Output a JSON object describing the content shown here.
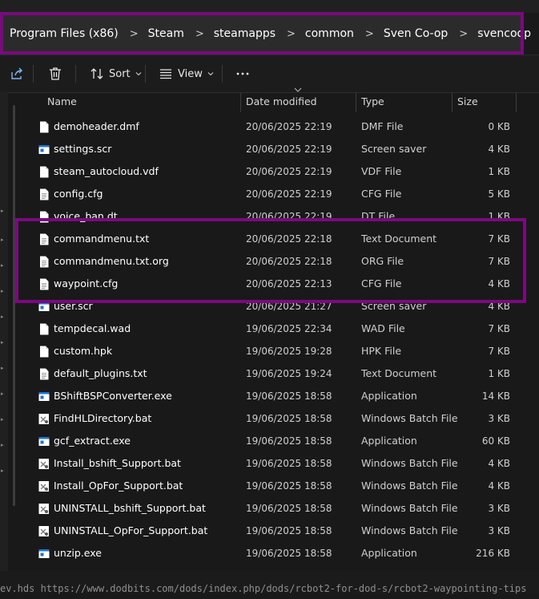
{
  "address": {
    "crumbs": [
      "Program Files (x86)",
      "Steam",
      "steamapps",
      "common",
      "Sven Co-op",
      "svencoop"
    ],
    "separator": ">"
  },
  "toolbar": {
    "share_icon": "share-icon",
    "delete_icon": "trash-icon",
    "sort_label": "Sort",
    "view_label": "View",
    "more_icon": "more-icon"
  },
  "columns": {
    "name": "Name",
    "date": "Date modified",
    "type": "Type",
    "size": "Size"
  },
  "files": [
    {
      "name": "demoheader.dmf",
      "date": "20/06/2025 22:19",
      "type": "DMF File",
      "size": "0 KB",
      "icon": "file-icon"
    },
    {
      "name": "settings.scr",
      "date": "20/06/2025 22:19",
      "type": "Screen saver",
      "size": "4 KB",
      "icon": "app-icon"
    },
    {
      "name": "steam_autocloud.vdf",
      "date": "20/06/2025 22:19",
      "type": "VDF File",
      "size": "1 KB",
      "icon": "file-icon"
    },
    {
      "name": "config.cfg",
      "date": "20/06/2025 22:19",
      "type": "CFG File",
      "size": "5 KB",
      "icon": "text-file-icon"
    },
    {
      "name": "voice_ban.dt",
      "date": "20/06/2025 22:19",
      "type": "DT File",
      "size": "1 KB",
      "icon": "file-icon"
    },
    {
      "name": "commandmenu.txt",
      "date": "20/06/2025 22:18",
      "type": "Text Document",
      "size": "7 KB",
      "icon": "text-file-icon"
    },
    {
      "name": "commandmenu.txt.org",
      "date": "20/06/2025 22:18",
      "type": "ORG File",
      "size": "7 KB",
      "icon": "text-file-icon"
    },
    {
      "name": "waypoint.cfg",
      "date": "20/06/2025 22:13",
      "type": "CFG File",
      "size": "4 KB",
      "icon": "text-file-icon"
    },
    {
      "name": "user.scr",
      "date": "20/06/2025 21:27",
      "type": "Screen saver",
      "size": "4 KB",
      "icon": "app-icon"
    },
    {
      "name": "tempdecal.wad",
      "date": "19/06/2025 22:34",
      "type": "WAD File",
      "size": "7 KB",
      "icon": "file-icon"
    },
    {
      "name": "custom.hpk",
      "date": "19/06/2025 19:28",
      "type": "HPK File",
      "size": "7 KB",
      "icon": "file-icon"
    },
    {
      "name": "default_plugins.txt",
      "date": "19/06/2025 19:24",
      "type": "Text Document",
      "size": "1 KB",
      "icon": "text-file-icon"
    },
    {
      "name": "BShiftBSPConverter.exe",
      "date": "19/06/2025 18:58",
      "type": "Application",
      "size": "14 KB",
      "icon": "app-icon"
    },
    {
      "name": "FindHLDirectory.bat",
      "date": "19/06/2025 18:58",
      "type": "Windows Batch File",
      "size": "3 KB",
      "icon": "batch-file-icon"
    },
    {
      "name": "gcf_extract.exe",
      "date": "19/06/2025 18:58",
      "type": "Application",
      "size": "60 KB",
      "icon": "app-icon"
    },
    {
      "name": "Install_bshift_Support.bat",
      "date": "19/06/2025 18:58",
      "type": "Windows Batch File",
      "size": "4 KB",
      "icon": "batch-file-icon"
    },
    {
      "name": "Install_OpFor_Support.bat",
      "date": "19/06/2025 18:58",
      "type": "Windows Batch File",
      "size": "4 KB",
      "icon": "batch-file-icon"
    },
    {
      "name": "UNINSTALL_bshift_Support.bat",
      "date": "19/06/2025 18:58",
      "type": "Windows Batch File",
      "size": "3 KB",
      "icon": "batch-file-icon"
    },
    {
      "name": "UNINSTALL_OpFor_Support.bat",
      "date": "19/06/2025 18:58",
      "type": "Windows Batch File",
      "size": "3 KB",
      "icon": "batch-file-icon"
    },
    {
      "name": "unzip.exe",
      "date": "19/06/2025 18:58",
      "type": "Application",
      "size": "216 KB",
      "icon": "app-icon"
    }
  ],
  "bottom_text": "ev.hds https://www.dodbits.com/dods/index.php/dods/rcbot2-for-dod-s/rcbot2-waypointing-tips",
  "colors": {
    "highlight": "#7a0a7f",
    "background": "#191919",
    "address_bar": "#2b2b2b",
    "app_icon_blue": "#1f74d0"
  }
}
